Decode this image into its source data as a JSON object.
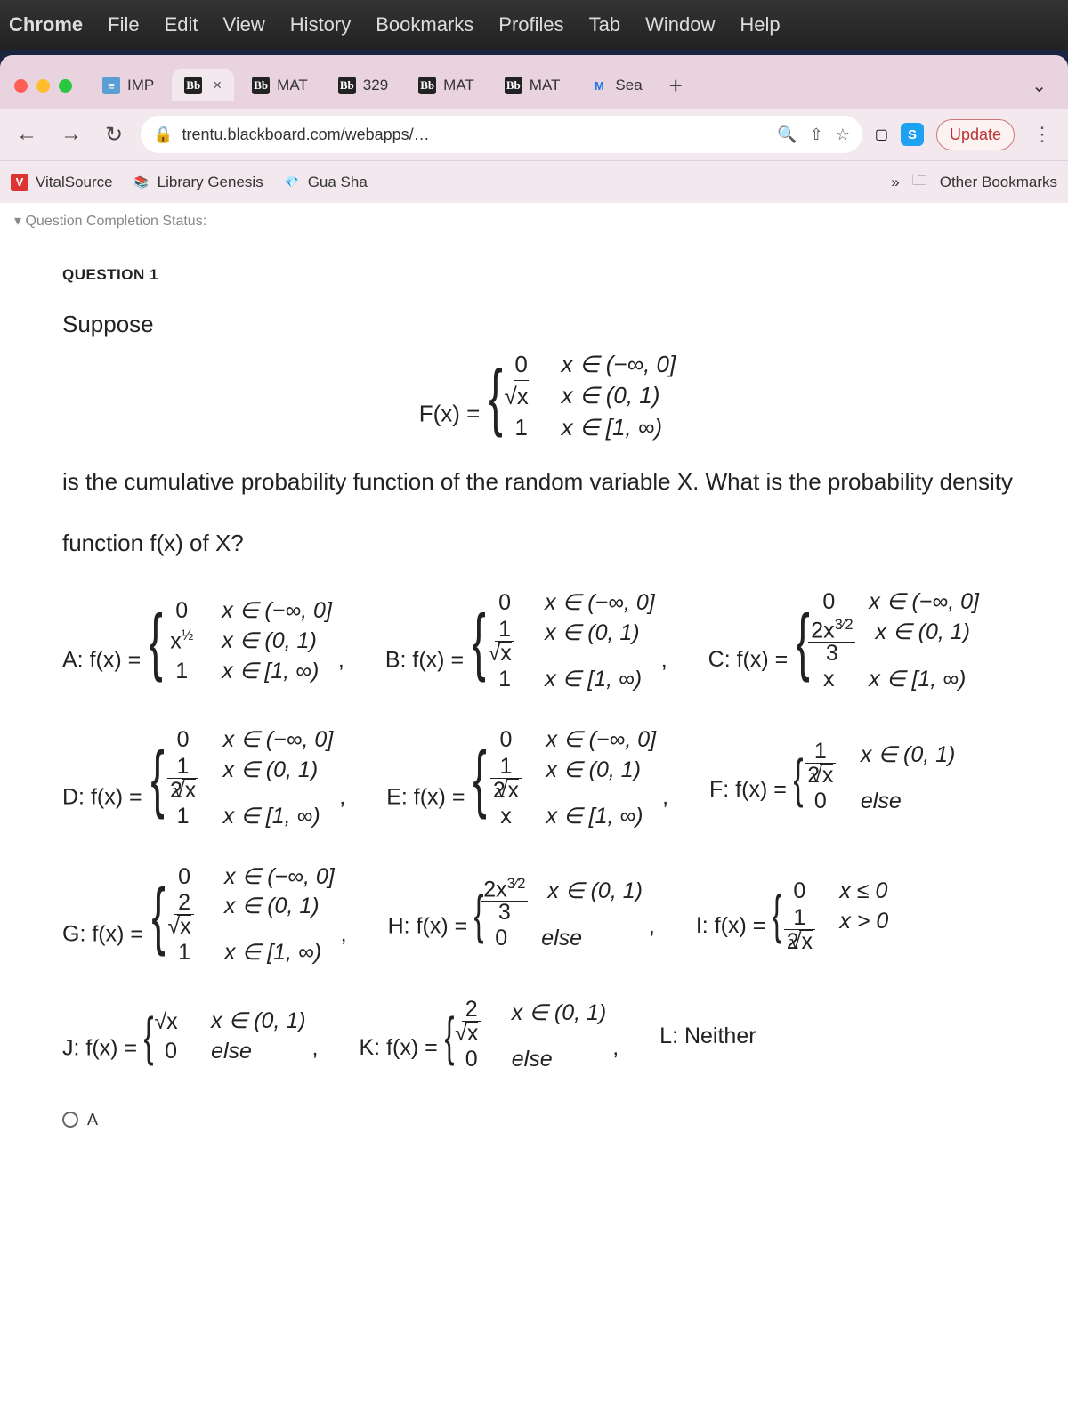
{
  "menubar": {
    "app": "Chrome",
    "items": [
      "File",
      "Edit",
      "View",
      "History",
      "Bookmarks",
      "Profiles",
      "Tab",
      "Window",
      "Help"
    ]
  },
  "tabs": {
    "items": [
      {
        "favicon": "≡",
        "favclass": "fav-imp",
        "label": "IMP"
      },
      {
        "favicon": "Bb",
        "favclass": "fav-bb",
        "label": "",
        "active": true
      },
      {
        "favicon": "Bb",
        "favclass": "fav-bb",
        "label": "MAT"
      },
      {
        "favicon": "Bb",
        "favclass": "fav-bb",
        "label": "329"
      },
      {
        "favicon": "Bb",
        "favclass": "fav-bb",
        "label": "MAT"
      },
      {
        "favicon": "Bb",
        "favclass": "fav-bb",
        "label": "MAT"
      },
      {
        "favicon": "M",
        "favclass": "fav-m",
        "label": "Sea"
      }
    ],
    "new": "+"
  },
  "addr": {
    "url": "trentu.blackboard.com/webapps/…",
    "update": "Update"
  },
  "bookmarks": {
    "items": [
      {
        "ico": "V",
        "icoclass": "ico-v",
        "label": "VitalSource"
      },
      {
        "ico": "📚",
        "icoclass": "",
        "label": "Library Genesis"
      },
      {
        "ico": "💎",
        "icoclass": "",
        "label": "Gua Sha"
      }
    ],
    "more": "»",
    "other": "Other Bookmarks"
  },
  "page": {
    "qcs": "▾ Question Completion Status:",
    "qnum": "QUESTION 1",
    "suppose": "Suppose",
    "desc1": "is the cumulative probability function of the random variable X. What is the probability density",
    "desc2": "function f(x) of X?",
    "answer_label": "A",
    "labels": {
      "A": "A:",
      "B": "B:",
      "C": "C:",
      "D": "D:",
      "E": "E:",
      "F": "F:",
      "G": "G:",
      "H": "H:",
      "I": "I:",
      "J": "J:",
      "K": "K:",
      "L": "L: Neither",
      "fx": "f(x) =",
      "Fx": "F(x) ="
    },
    "cond": {
      "neg": "x ∈ (−∞, 0]",
      "mid": "x ∈ (0, 1)",
      "top": "x ∈ [1, ∞)",
      "le0": "x ≤ 0",
      "gt0": "x > 0",
      "else": "else"
    }
  }
}
